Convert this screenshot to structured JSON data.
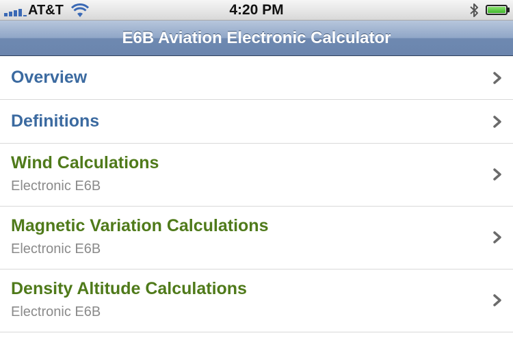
{
  "status_bar": {
    "carrier": "AT&T",
    "time": "4:20 PM",
    "signal_bars": 5,
    "battery_level": 1.0,
    "icons": [
      "signal-icon",
      "wifi-icon",
      "bluetooth-icon",
      "battery-icon"
    ]
  },
  "nav": {
    "title": "E6B Aviation Electronic Calculator"
  },
  "colors": {
    "blue_title": "#3b6aa0",
    "green_title": "#4f7a1a",
    "subtitle": "#8a8a8a"
  },
  "list": {
    "items": [
      {
        "title": "Overview",
        "subtitle": ""
      },
      {
        "title": "Definitions",
        "subtitle": ""
      },
      {
        "title": "Wind Calculations",
        "subtitle": "Electronic E6B"
      },
      {
        "title": "Magnetic Variation Calculations",
        "subtitle": "Electronic E6B"
      },
      {
        "title": "Density Altitude Calculations",
        "subtitle": "Electronic E6B"
      }
    ]
  }
}
